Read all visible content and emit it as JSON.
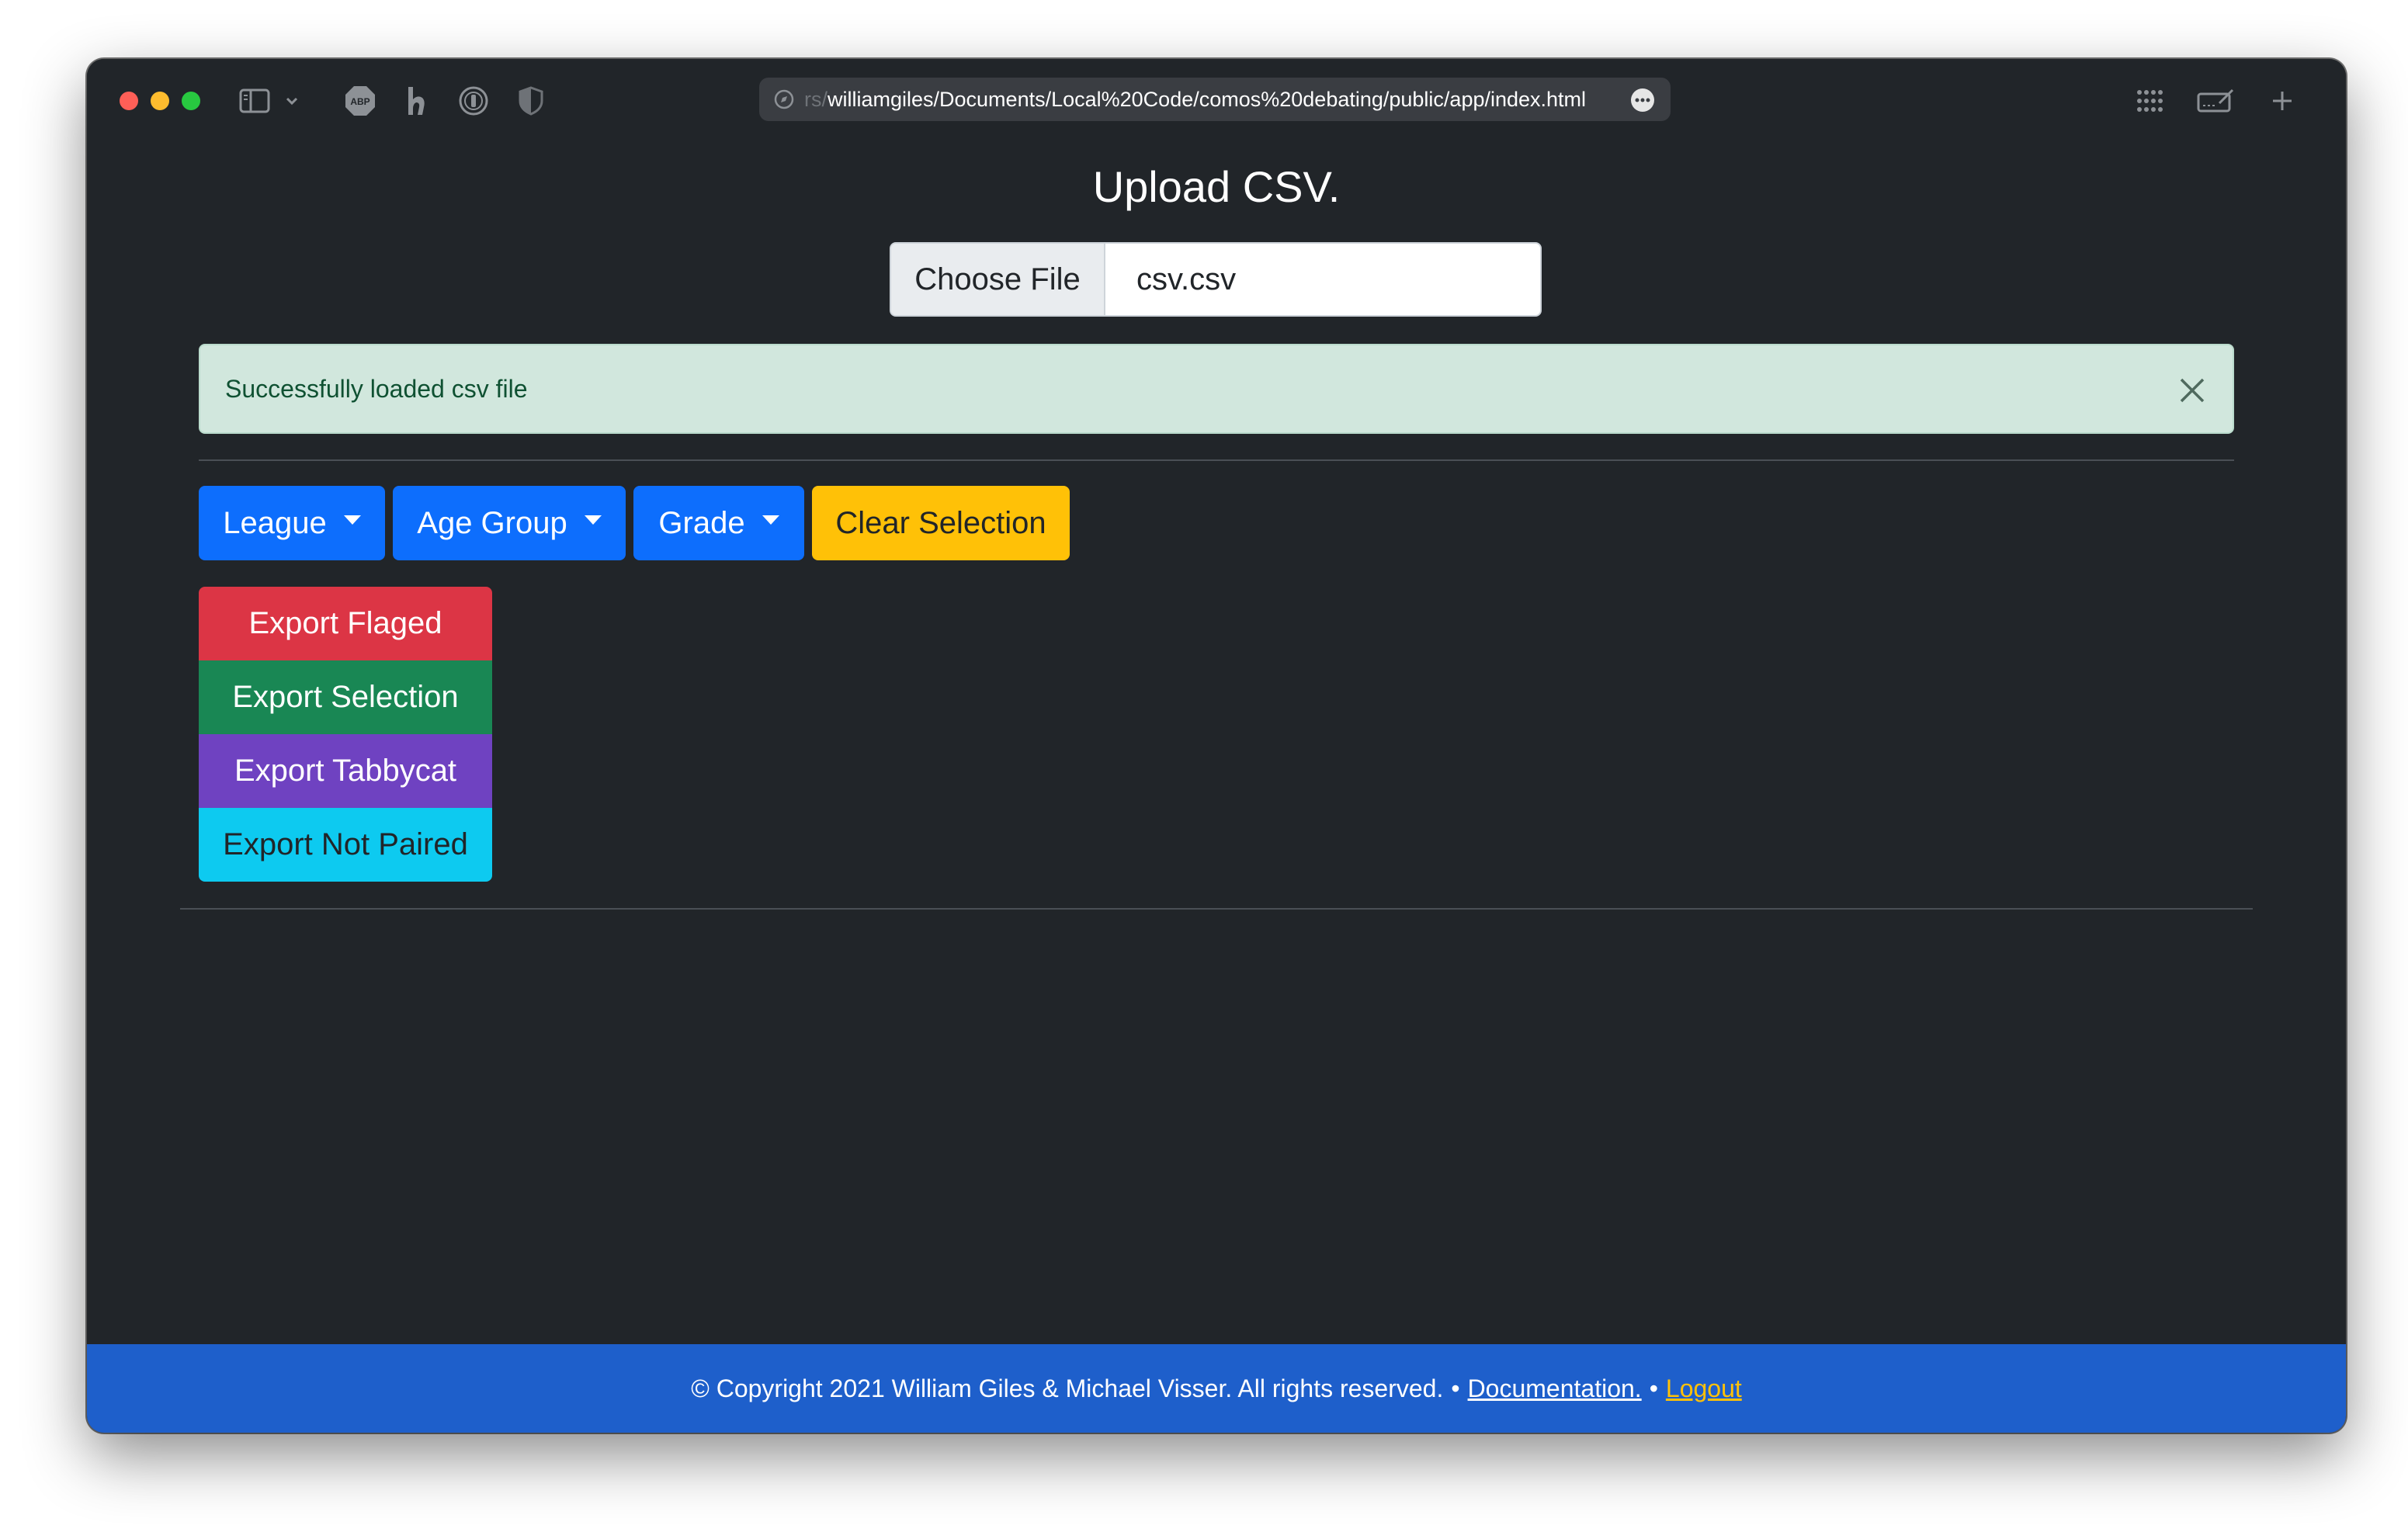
{
  "browser": {
    "url_prefix": "rs/",
    "url": "williamgiles/Documents/Local%20Code/comos%20debating/public/app/index.html"
  },
  "page": {
    "title": "Upload CSV."
  },
  "file_input": {
    "button_label": "Choose File",
    "file_name": "csv.csv"
  },
  "alert": {
    "message": "Successfully loaded csv file"
  },
  "filters": {
    "league_label": "League",
    "age_group_label": "Age Group",
    "grade_label": "Grade",
    "clear_label": "Clear Selection"
  },
  "exports": {
    "flaged_label": "Export Flaged",
    "selection_label": "Export Selection",
    "tabbycat_label": "Export Tabbycat",
    "not_paired_label": "Export Not Paired"
  },
  "footer": {
    "copyright": "© Copyright 2021 William Giles & Michael Visser. All rights reserved.",
    "separator": "•",
    "documentation_label": "Documentation.",
    "logout_label": "Logout"
  },
  "colors": {
    "primary": "#0d6efd",
    "warning": "#ffc107",
    "danger": "#dc3545",
    "success": "#198754",
    "purple": "#6f42c1",
    "info": "#0dcaf0",
    "footer": "#1e5fcb"
  }
}
